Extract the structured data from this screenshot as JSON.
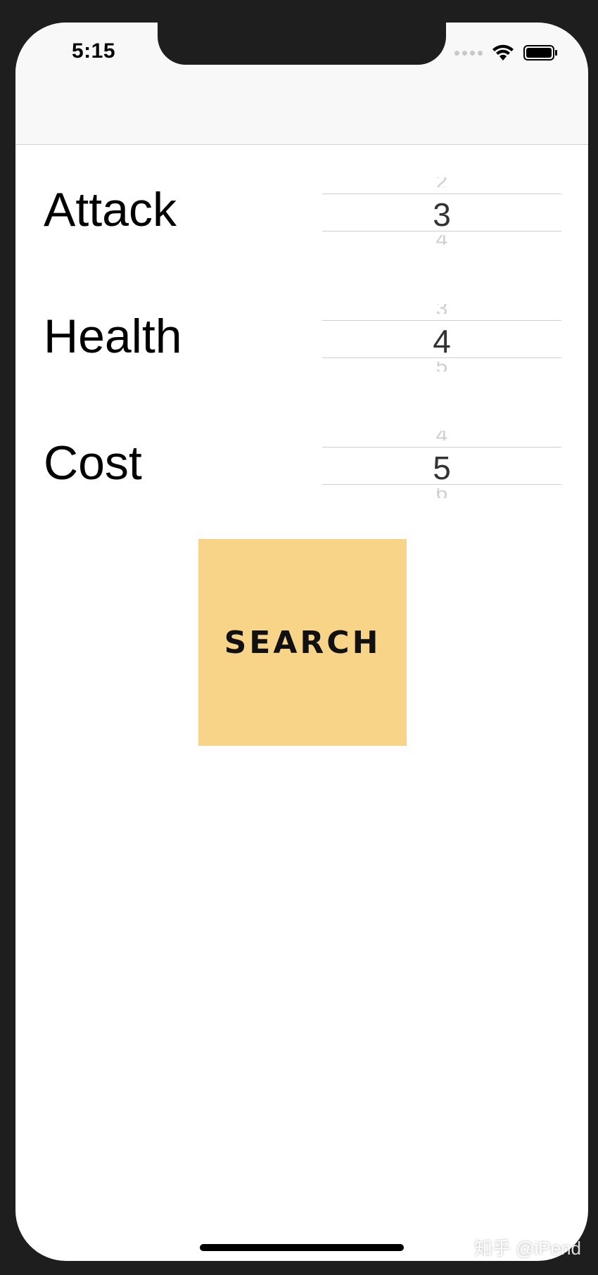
{
  "status_bar": {
    "time": "5:15"
  },
  "icons": {
    "wifi": "wifi-icon",
    "battery": "battery-icon",
    "signal": "cellular-signal-icon"
  },
  "form": {
    "rows": [
      {
        "label": "Attack",
        "value": "3"
      },
      {
        "label": "Health",
        "value": "4"
      },
      {
        "label": "Cost",
        "value": "5"
      }
    ]
  },
  "search_button": {
    "label": "SEARCH",
    "background": "#f7d487"
  },
  "watermark": "知乎 @iPend"
}
